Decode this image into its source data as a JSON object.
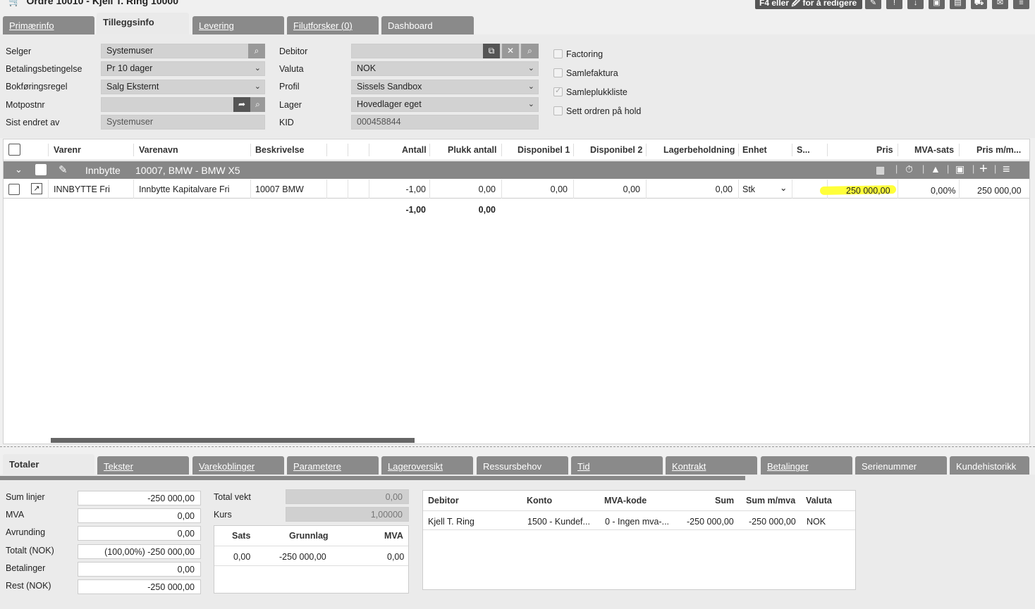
{
  "header": {
    "title": "Ordre 10010 - Kjell T. Ring 10000",
    "edit_hint": "F4 eller 🖉 for å redigere"
  },
  "tabs": [
    "Primærinfo",
    "Tilleggsinfo",
    "Levering",
    "Filutforsker (0)",
    "Dashboard"
  ],
  "form": {
    "selger_label": "Selger",
    "selger": "Systemuser",
    "betaling_label": "Betalingsbetingelse",
    "betaling": "Pr 10 dager",
    "bokforing_label": "Bokføringsregel",
    "bokforing": "Salg Eksternt",
    "motpost_label": "Motpostnr",
    "motpost": "",
    "sist_label": "Sist endret av",
    "sist": "Systemuser",
    "debitor_label": "Debitor",
    "debitor": "",
    "valuta_label": "Valuta",
    "valuta": "NOK",
    "profil_label": "Profil",
    "profil": "Sissels Sandbox",
    "lager_label": "Lager",
    "lager": "Hovedlager eget",
    "kid_label": "KID",
    "kid": "000458844",
    "cb_factoring": "Factoring",
    "cb_samlefaktura": "Samlefaktura",
    "cb_samleplukk": "Samleplukkliste",
    "cb_hold": "Sett ordren på hold"
  },
  "grid": {
    "headers": {
      "varenr": "Varenr",
      "varenavn": "Varenavn",
      "beskrivelse": "Beskrivelse",
      "antall": "Antall",
      "plukk": "Plukk antall",
      "disp1": "Disponibel 1",
      "disp2": "Disponibel 2",
      "lager": "Lagerbeholdning",
      "enhet": "Enhet",
      "s": "S...",
      "pris": "Pris",
      "mva": "MVA-sats",
      "prism": "Pris m/m..."
    },
    "group": {
      "name": "Innbytte",
      "desc": "10007, BMW - BMW X5"
    },
    "row": {
      "varenr": "INNBYTTE Fri",
      "varenavn": "Innbytte Kapitalvare Fri",
      "beskrivelse": "10007 BMW",
      "antall": "-1,00",
      "plukk": "0,00",
      "disp1": "0,00",
      "disp2": "0,00",
      "lager": "0,00",
      "enhet": "Stk",
      "pris": "250 000,00",
      "mva": "0,00%",
      "prism": "250 000,00"
    },
    "totals": {
      "antall": "-1,00",
      "plukk": "0,00"
    }
  },
  "tabs2": [
    "Totaler",
    "Tekster",
    "Varekoblinger",
    "Parametere",
    "Lageroversikt",
    "Ressursbehov",
    "Tid",
    "Kontrakt",
    "Betalinger",
    "Serienummer",
    "Kundehistorikk"
  ],
  "totals": {
    "sum_label": "Sum linjer",
    "sum": "-250 000,00",
    "mva_label": "MVA",
    "mva": "0,00",
    "avr_label": "Avrunding",
    "avr": "0,00",
    "tot_label": "Totalt (NOK)",
    "tot": "(100,00%) -250 000,00",
    "bet_label": "Betalinger",
    "bet": "0,00",
    "rest_label": "Rest (NOK)",
    "rest": "-250 000,00",
    "vekt_label": "Total vekt",
    "vekt": "0,00",
    "kurs_label": "Kurs",
    "kurs": "1,00000"
  },
  "vat": {
    "h_sats": "Sats",
    "h_grunn": "Grunnlag",
    "h_mva": "MVA",
    "sats": "0,00",
    "grunn": "-250 000,00",
    "mva": "0,00"
  },
  "ledger": {
    "h_debitor": "Debitor",
    "h_konto": "Konto",
    "h_mvakode": "MVA-kode",
    "h_sum": "Sum",
    "h_summva": "Sum m/mva",
    "h_valuta": "Valuta",
    "debitor": "Kjell T. Ring",
    "konto": "1500 - Kundef...",
    "mvakode": "0 - Ingen mva-...",
    "sum": "-250 000,00",
    "summva": "-250 000,00",
    "valuta": "NOK"
  },
  "colors": {
    "tab": "#8a8a8a",
    "group": "#878787",
    "highlight": "#ffff3a"
  }
}
